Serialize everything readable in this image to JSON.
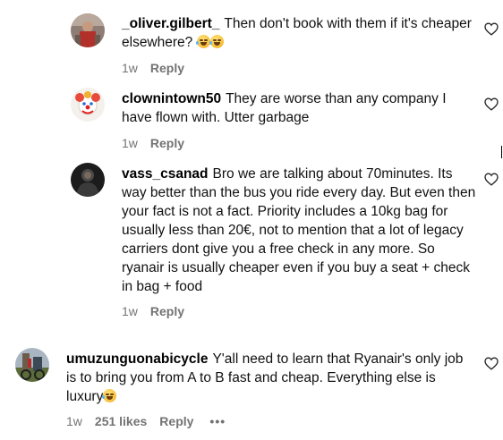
{
  "comments": [
    {
      "username": "_oliver.gilbert_",
      "text": "Then don't book with them if it's cheaper elsewhere?",
      "emoji": "laughing-crying-emoji",
      "time": "1w",
      "reply_label": "Reply"
    },
    {
      "username": "clownintown50",
      "text": "They are worse than any company I have flown with. Utter garbage",
      "time": "1w",
      "reply_label": "Reply"
    },
    {
      "username": "vass_csanad",
      "text": "Bro we are talking about 70minutes. Its way better than the bus you ride every day. But even then your fact is not a fact. Priority includes a 10kg bag for usually less than 20€, not to mention that a lot of legacy carriers dont give you a free check in any more. So ryanair is usually cheaper even if you buy a seat + check in bag + food",
      "time": "1w",
      "reply_label": "Reply"
    },
    {
      "username": "umuzunguonabicycle",
      "text": "Y'all need to learn that Ryanair's only job is to bring you from A to B fast and cheap. Everything else is luxury",
      "emoji": "laughing-crying-emoji",
      "time": "1w",
      "likes": "251 likes",
      "reply_label": "Reply",
      "more_label": "•••"
    }
  ],
  "icons": {
    "like": "heart-outline-icon"
  },
  "colors": {
    "text": "#111111",
    "meta": "#737373",
    "background": "#ffffff"
  }
}
